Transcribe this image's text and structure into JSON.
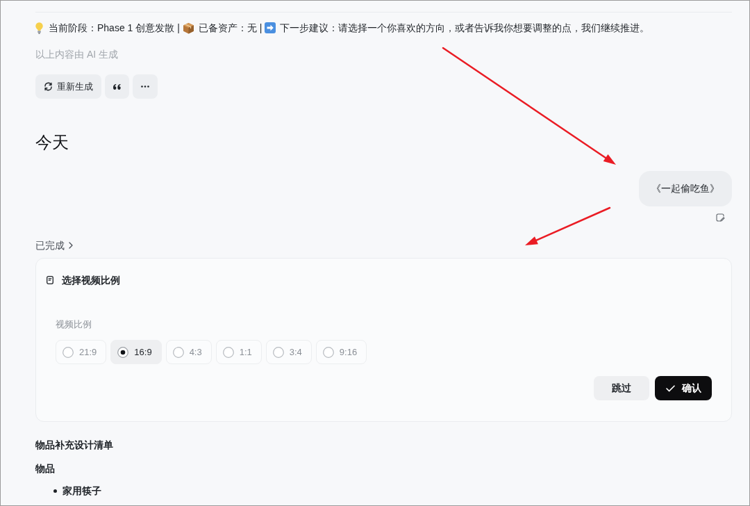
{
  "status_line": [
    "当前阶段：Phase 1 创意发散 |",
    "已备资产：无 |",
    "下一步建议：请选择一个你喜欢的方向，或者告诉我你想要调整的点，我们继续推进。"
  ],
  "ai_notice": "以上内容由 AI 生成",
  "regenerate_button": {
    "label": "重新生成"
  },
  "date_heading": "今天",
  "user_message": {
    "text": "《一起偷吃鱼》"
  },
  "status_toggle": {
    "label": "已完成",
    "expanded": false
  },
  "choice_card": {
    "title": "选择视频比例",
    "field_label": "视频比例",
    "options": [
      {
        "label": "21:9",
        "selected": false
      },
      {
        "label": "16:9",
        "selected": true
      },
      {
        "label": "4:3",
        "selected": false
      },
      {
        "label": "1:1",
        "selected": false
      },
      {
        "label": "3:4",
        "selected": false
      },
      {
        "label": "9:16",
        "selected": false
      }
    ],
    "skip_button": "跳过",
    "confirm_button": "确认"
  },
  "content": {
    "heading": "物品补充设计清单",
    "subheading": "物品",
    "items": [
      "家用筷子"
    ]
  }
}
